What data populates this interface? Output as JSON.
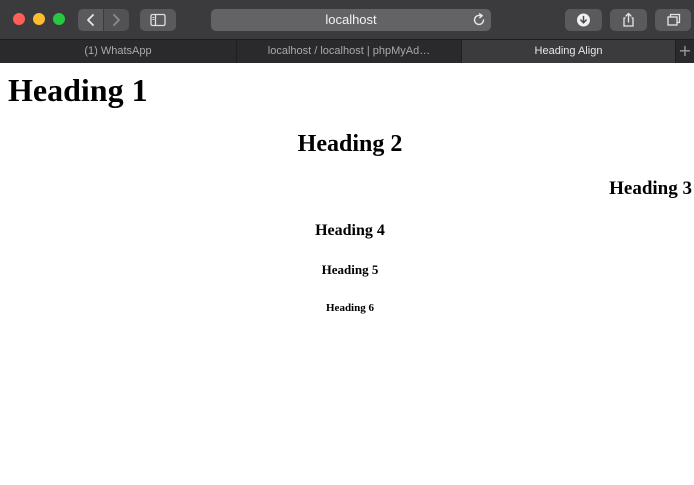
{
  "browser": {
    "url": "localhost",
    "tabs": [
      {
        "label": "(1) WhatsApp",
        "active": false
      },
      {
        "label": "localhost / localhost | phpMyAd…",
        "active": false
      },
      {
        "label": "Heading Align",
        "active": true
      }
    ],
    "icons": [
      "back-icon",
      "forward-icon",
      "sidebar-icon",
      "reload-icon",
      "download-icon",
      "share-icon",
      "tabs-overview-icon",
      "plus-icon"
    ],
    "colors": {
      "toolbar": "#3b3a3c",
      "close": "#fe5f57",
      "minimize": "#febc2e",
      "zoom": "#28c840"
    }
  },
  "page": {
    "headings": {
      "h1": {
        "text": "Heading 1",
        "align": "left"
      },
      "h2": {
        "text": "Heading 2",
        "align": "center"
      },
      "h3": {
        "text": "Heading 3",
        "align": "right"
      },
      "h4": {
        "text": "Heading 4",
        "align": "center"
      },
      "h5": {
        "text": "Heading 5",
        "align": "center"
      },
      "h6": {
        "text": "Heading 6",
        "align": "center"
      }
    }
  }
}
